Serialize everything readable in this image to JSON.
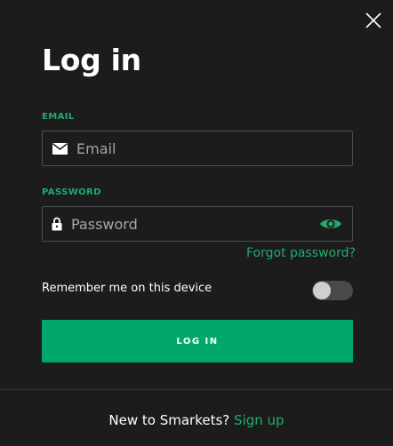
{
  "modal": {
    "title": "Log in",
    "close_icon": "close-icon"
  },
  "email": {
    "label": "EMAIL",
    "placeholder": "Email",
    "value": "",
    "icon": "envelope-icon"
  },
  "password": {
    "label": "PASSWORD",
    "placeholder": "Password",
    "value": "",
    "icon": "lock-icon",
    "reveal_icon": "eye-icon"
  },
  "forgot_password": "Forgot password?",
  "remember": {
    "label": "Remember me on this device",
    "enabled": false
  },
  "login_button": "LOG IN",
  "footer": {
    "prompt": "New to Smarkets?",
    "signup_link": "Sign up"
  },
  "colors": {
    "background": "#1c1c1c",
    "accent": "#1fac6b",
    "button": "#00a86b",
    "border": "#4d4d4d"
  }
}
